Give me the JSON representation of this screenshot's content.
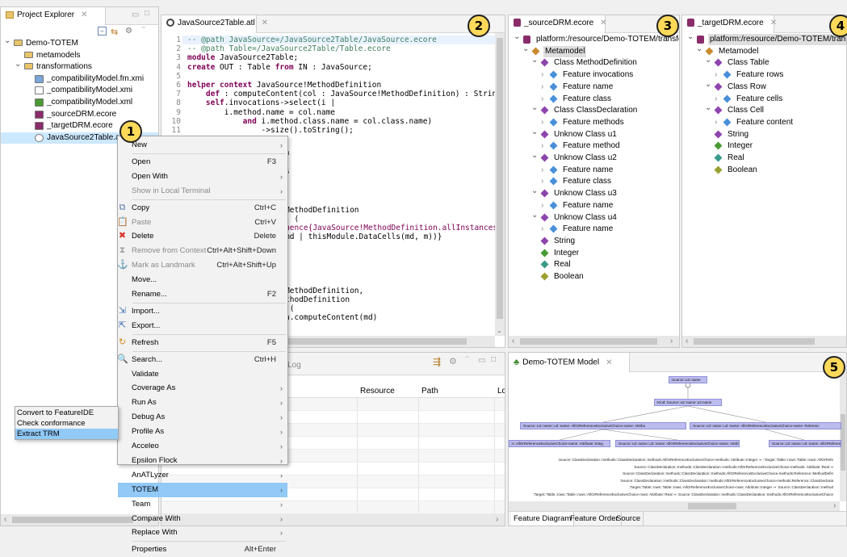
{
  "explorer": {
    "tab_title": "Project Explorer",
    "tree": [
      {
        "label": "Demo-TOTEM",
        "icon": "project-folder-icon",
        "level": 0,
        "expand": "open"
      },
      {
        "label": "metamodels",
        "icon": "folder-icon",
        "level": 1,
        "expand": "none"
      },
      {
        "label": "transformations",
        "icon": "folder-icon",
        "level": 1,
        "expand": "open"
      },
      {
        "label": "_compatibilityModel.fm.xmi",
        "icon": "image-file-icon",
        "level": 2,
        "expand": "none"
      },
      {
        "label": "_compatibilityModel.xmi",
        "icon": "xmi-file-icon",
        "level": 2,
        "expand": "none"
      },
      {
        "label": "_compatibilityModel.xml",
        "icon": "tree-model-icon",
        "level": 2,
        "expand": "none"
      },
      {
        "label": "_sourceDRM.ecore",
        "icon": "ecore-file-icon",
        "level": 2,
        "expand": "none"
      },
      {
        "label": "_targetDRM.ecore",
        "icon": "ecore-file-icon",
        "level": 2,
        "expand": "none"
      },
      {
        "label": "JavaSource2Table.atl",
        "icon": "atl-file-icon",
        "level": 2,
        "expand": "none",
        "selected": true
      }
    ]
  },
  "editor": {
    "tab_title": "JavaSource2Table.atl",
    "lines": [
      {
        "n": "1",
        "parts": [
          {
            "t": "-- @path JavaSource=/JavaSource2Table/JavaSource.ecore",
            "c": "cm"
          }
        ]
      },
      {
        "n": "2",
        "parts": [
          {
            "t": "-- @path Table=/JavaSource2Table/Table.ecore",
            "c": "cm"
          }
        ]
      },
      {
        "n": "3",
        "parts": [
          {
            "t": "module",
            "c": "kw"
          },
          {
            "t": " JavaSource2Table;",
            "c": ""
          }
        ]
      },
      {
        "n": "4",
        "parts": [
          {
            "t": "create",
            "c": "kw"
          },
          {
            "t": " OUT : Table ",
            "c": ""
          },
          {
            "t": "from",
            "c": "kw"
          },
          {
            "t": " IN : JavaSource;",
            "c": ""
          }
        ]
      },
      {
        "n": "5",
        "parts": []
      },
      {
        "n": "6",
        "parts": [
          {
            "t": "helper context",
            "c": "kw"
          },
          {
            "t": " JavaSource!MethodDefinition",
            "c": ""
          }
        ]
      },
      {
        "n": "7",
        "parts": [
          {
            "t": "    def",
            "c": "kw"
          },
          {
            "t": " : computeContent(col : JavaSource!MethodDefinition) : String =",
            "c": ""
          }
        ]
      },
      {
        "n": "8",
        "parts": [
          {
            "t": "    self",
            "c": "kw"
          },
          {
            "t": ".invocations->select(i |",
            "c": ""
          }
        ]
      },
      {
        "n": "9",
        "parts": [
          {
            "t": "        i.method.name = col.name",
            "c": ""
          }
        ]
      },
      {
        "n": "10",
        "parts": [
          {
            "t": "            and",
            "c": "kw"
          },
          {
            "t": " i.method.class.name = col.class.name)",
            "c": ""
          }
        ]
      },
      {
        "n": "11",
        "parts": [
          {
            "t": "                ->size().toString();",
            "c": ""
          }
        ]
      }
    ],
    "visible_fragments": [
      {
        "t": "ClassDeclaration",
        "c": ""
      },
      {
        "t": "s",
        "c": ""
      },
      {
        "t": "MethodDefinition",
        "c": ""
      },
      {
        "t": ") (",
        "c": ""
      },
      {
        "t": "uence{JavaSource!MethodDefinition.allInstances",
        "c": "kw-part"
      },
      {
        "t": "md | thisModule.DataCells(md, m))}",
        "c": ""
      },
      {
        "t": "MethodDefinition,",
        "c": ""
      },
      {
        "t": "thodDefinition",
        "c": ""
      },
      {
        "t": " (",
        "c": ""
      },
      {
        "t": "n.computeContent(md)",
        "c": ""
      }
    ]
  },
  "source_view": {
    "tab_title": "_sourceDRM.ecore",
    "tree": [
      {
        "label": "platform:/resource/Demo-TOTEM/transformatio",
        "icon": "resource",
        "level": 0,
        "expand": "open"
      },
      {
        "label": "Metamodel",
        "icon": "package",
        "level": 1,
        "expand": "open",
        "selected": true
      },
      {
        "label": "Class MethodDefinition",
        "icon": "class",
        "level": 2,
        "expand": "open"
      },
      {
        "label": "Feature invocations",
        "icon": "feature",
        "level": 3,
        "expand": "closed"
      },
      {
        "label": "Feature name",
        "icon": "feature",
        "level": 3,
        "expand": "closed"
      },
      {
        "label": "Feature class",
        "icon": "feature",
        "level": 3,
        "expand": "closed"
      },
      {
        "label": "Class ClassDeclaration",
        "icon": "class",
        "level": 2,
        "expand": "open"
      },
      {
        "label": "Feature methods",
        "icon": "feature",
        "level": 3,
        "expand": "closed"
      },
      {
        "label": "Unknow Class u1",
        "icon": "class",
        "level": 2,
        "expand": "open"
      },
      {
        "label": "Feature method",
        "icon": "feature",
        "level": 3,
        "expand": "closed"
      },
      {
        "label": "Unknow Class u2",
        "icon": "class",
        "level": 2,
        "expand": "open"
      },
      {
        "label": "Feature name",
        "icon": "feature",
        "level": 3,
        "expand": "closed"
      },
      {
        "label": "Feature class",
        "icon": "feature",
        "level": 3,
        "expand": "closed"
      },
      {
        "label": "Unknow Class u3",
        "icon": "class",
        "level": 2,
        "expand": "open"
      },
      {
        "label": "Feature name",
        "icon": "feature",
        "level": 3,
        "expand": "closed"
      },
      {
        "label": "Unknow Class u4",
        "icon": "class",
        "level": 2,
        "expand": "open"
      },
      {
        "label": "Feature name",
        "icon": "feature",
        "level": 3,
        "expand": "closed"
      },
      {
        "label": "String",
        "icon": "datatype-string",
        "level": 2,
        "expand": "none"
      },
      {
        "label": "Integer",
        "icon": "datatype-integer",
        "level": 2,
        "expand": "none"
      },
      {
        "label": "Real",
        "icon": "datatype-real",
        "level": 2,
        "expand": "none"
      },
      {
        "label": "Boolean",
        "icon": "datatype-boolean",
        "level": 2,
        "expand": "none"
      }
    ]
  },
  "target_view": {
    "tab_title": "_targetDRM.ecore",
    "tree": [
      {
        "label": "platform:/resource/Demo-TOTEM/transformati",
        "icon": "resource",
        "level": 0,
        "expand": "open",
        "selected": true
      },
      {
        "label": "Metamodel",
        "icon": "package",
        "level": 1,
        "expand": "open"
      },
      {
        "label": "Class Table",
        "icon": "class",
        "level": 2,
        "expand": "open"
      },
      {
        "label": "Feature rows",
        "icon": "feature",
        "level": 3,
        "expand": "closed"
      },
      {
        "label": "Class Row",
        "icon": "class",
        "level": 2,
        "expand": "open"
      },
      {
        "label": "Feature cells",
        "icon": "feature",
        "level": 3,
        "expand": "closed"
      },
      {
        "label": "Class Cell",
        "icon": "class",
        "level": 2,
        "expand": "open"
      },
      {
        "label": "Feature content",
        "icon": "feature",
        "level": 3,
        "expand": "closed"
      },
      {
        "label": "String",
        "icon": "datatype-string",
        "level": 2,
        "expand": "none"
      },
      {
        "label": "Integer",
        "icon": "datatype-integer",
        "level": 2,
        "expand": "none"
      },
      {
        "label": "Real",
        "icon": "datatype-real",
        "level": 2,
        "expand": "none"
      },
      {
        "label": "Boolean",
        "icon": "datatype-boolean",
        "level": 2,
        "expand": "none"
      }
    ]
  },
  "error_log": {
    "tab_fragment": "r Log",
    "columns": [
      "Resource",
      "Path",
      "Lc"
    ]
  },
  "model_view": {
    "tab_title": "Demo-TOTEM Model",
    "bottom_tabs": [
      "Feature Diagram",
      "Feature Order",
      "Source"
    ],
    "nodes": [
      {
        "label": ":Source::u3::name"
      },
      {
        "label": ":Kind::Source::u3::name::u3.name"
      },
      {
        "label": ":Source::u3::name::u3::name: AllOrReferenceExclusiveChoice-name: Attribu"
      },
      {
        "label": ":Source::u3::name::u3::name: AllOrReferenceExclusiveChoice-name: Referenc"
      },
      {
        "label": ":s: AllOrReferenceExclusiveChoice-name: Attribute::Integ"
      },
      {
        "label": ":Source::u3::name::u3::name: AllOrReferenceExclusiveChoice-name: Attribute::Re"
      },
      {
        "label": ":Source::u3::name::u3::name: AllOrReferenceExclusiveChoice-name: Attribute::Real"
      }
    ],
    "constraints": [
      ":Source::ClassDeclaration::methods::ClassDeclaration::methods:AllOrReferenceExclusiveChoice-methods: Attribute::Integer ⇒ ::Target::Table::rows::Table::rows::AllOrRefe",
      ":Source::ClassDeclaration::methods::ClassDeclaration::methods:AllOrReferenceExclusiveChoice-methods: Attribute::Real ⇒",
      ":Source::ClassDeclaration::methods::ClassDeclaration::methods:AllOrReferenceExclusiveChoice-methods:Reference::MethodDefin",
      ":Source::ClassDeclaration::methods::ClassDeclaration::methods:AllOrReferenceExclusiveChoice-methods:Reference::ClassDeclarat",
      ":Target::Table::rows::Table::rows::AllOrReferenceExclusiveChoice-rows: Attribute::Integer ⇒ :Source::ClassDeclaration::method",
      ":Target::Table::rows::Table::rows::AllOrReferenceExclusiveChoice-rows: Attribute::Real ⇒ :Source::ClassDeclaration::methods::ClassDeclaration::methods:AllOrReferenceExclusiveChoice"
    ]
  },
  "context_menu": {
    "items": [
      {
        "label": "New",
        "shortcut": "",
        "arrow": true,
        "icon": "",
        "disabled": false
      },
      {
        "sep": true
      },
      {
        "label": "Open",
        "shortcut": "F3",
        "arrow": false,
        "icon": "",
        "disabled": false
      },
      {
        "label": "Open With",
        "shortcut": "",
        "arrow": true,
        "icon": "",
        "disabled": false
      },
      {
        "label": "Show in Local Terminal",
        "shortcut": "",
        "arrow": true,
        "icon": "",
        "disabled": true
      },
      {
        "sep": true
      },
      {
        "label": "Copy",
        "shortcut": "Ctrl+C",
        "arrow": false,
        "icon": "copy-icon",
        "disabled": false
      },
      {
        "label": "Paste",
        "shortcut": "Ctrl+V",
        "arrow": false,
        "icon": "paste-icon",
        "disabled": true
      },
      {
        "label": "Delete",
        "shortcut": "Delete",
        "arrow": false,
        "icon": "delete-icon",
        "disabled": false
      },
      {
        "label": "Remove from Context",
        "shortcut": "Ctrl+Alt+Shift+Down",
        "arrow": false,
        "icon": "remove-context-icon",
        "disabled": true
      },
      {
        "label": "Mark as Landmark",
        "shortcut": "Ctrl+Alt+Shift+Up",
        "arrow": false,
        "icon": "landmark-icon",
        "disabled": true
      },
      {
        "label": "Move...",
        "shortcut": "",
        "arrow": false,
        "icon": "",
        "disabled": false
      },
      {
        "label": "Rename...",
        "shortcut": "F2",
        "arrow": false,
        "icon": "",
        "disabled": false
      },
      {
        "sep": true
      },
      {
        "label": "Import...",
        "shortcut": "",
        "arrow": false,
        "icon": "import-icon",
        "disabled": false
      },
      {
        "label": "Export...",
        "shortcut": "",
        "arrow": false,
        "icon": "export-icon",
        "disabled": false
      },
      {
        "sep": true
      },
      {
        "label": "Refresh",
        "shortcut": "F5",
        "arrow": false,
        "icon": "refresh-icon",
        "disabled": false
      },
      {
        "sep": true
      },
      {
        "label": "Search...",
        "shortcut": "Ctrl+H",
        "arrow": false,
        "icon": "search-icon",
        "disabled": false
      },
      {
        "label": "Validate",
        "shortcut": "",
        "arrow": false,
        "icon": "",
        "disabled": false
      },
      {
        "label": "Coverage As",
        "shortcut": "",
        "arrow": true,
        "icon": "",
        "disabled": false
      },
      {
        "label": "Run As",
        "shortcut": "",
        "arrow": true,
        "icon": "",
        "disabled": false
      },
      {
        "label": "Debug As",
        "shortcut": "",
        "arrow": true,
        "icon": "",
        "disabled": false
      },
      {
        "label": "Profile As",
        "shortcut": "",
        "arrow": true,
        "icon": "",
        "disabled": false
      },
      {
        "label": "Acceleo",
        "shortcut": "",
        "arrow": true,
        "icon": "",
        "disabled": false
      },
      {
        "label": "Epsilon Flock",
        "shortcut": "",
        "arrow": true,
        "icon": "",
        "disabled": false
      },
      {
        "label": "AnATLyzer",
        "shortcut": "",
        "arrow": true,
        "icon": "",
        "disabled": false
      },
      {
        "label": "TOTEM",
        "shortcut": "",
        "arrow": true,
        "icon": "",
        "disabled": false,
        "selected": true
      },
      {
        "label": "Team",
        "shortcut": "",
        "arrow": true,
        "icon": "",
        "disabled": false
      },
      {
        "label": "Compare With",
        "shortcut": "",
        "arrow": true,
        "icon": "",
        "disabled": false
      },
      {
        "label": "Replace With",
        "shortcut": "",
        "arrow": true,
        "icon": "",
        "disabled": false
      },
      {
        "sep": true
      },
      {
        "label": "Properties",
        "shortcut": "Alt+Enter",
        "arrow": false,
        "icon": "",
        "disabled": false
      }
    ]
  },
  "submenu": {
    "items": [
      {
        "label": "Convert to FeatureIDE"
      },
      {
        "label": "Check conformance"
      },
      {
        "label": "Extract TRM",
        "selected": true
      }
    ]
  },
  "badges": [
    "1",
    "2",
    "3",
    "4",
    "5"
  ],
  "colors": {
    "selection": "#cce8ff",
    "menu_highlight": "#91c9f7",
    "badge": "#ffd95a",
    "node_fill": "#bcbcef",
    "comment": "#3f7f5f",
    "keyword": "#7f0055"
  }
}
